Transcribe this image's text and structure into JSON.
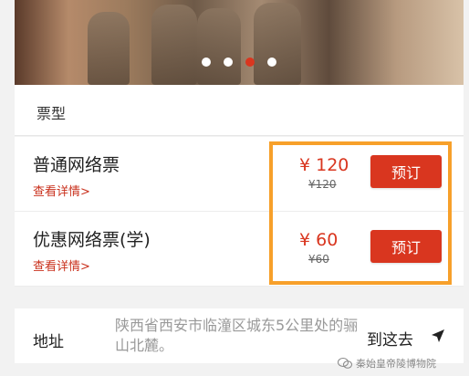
{
  "banner": {
    "dots": 4,
    "active_dot": 2
  },
  "ticket_section": {
    "title": "票型"
  },
  "tickets": [
    {
      "name": "普通网络票",
      "detail_label": "查看详情>",
      "price": "¥ 120",
      "original_price": "¥120",
      "book_label": "预订"
    },
    {
      "name": "优惠网络票(学)",
      "detail_label": "查看详情>",
      "price": "¥ 60",
      "original_price": "¥60",
      "book_label": "预订"
    }
  ],
  "address": {
    "label": "地址",
    "text": "陕西省西安市临潼区城东5公里处的骊山北麓。",
    "nav_label": "到这去"
  },
  "watermark": {
    "text": "秦始皇帝陵博物院"
  },
  "colors": {
    "accent": "#d9361f",
    "highlight_border": "#f7a02a"
  }
}
